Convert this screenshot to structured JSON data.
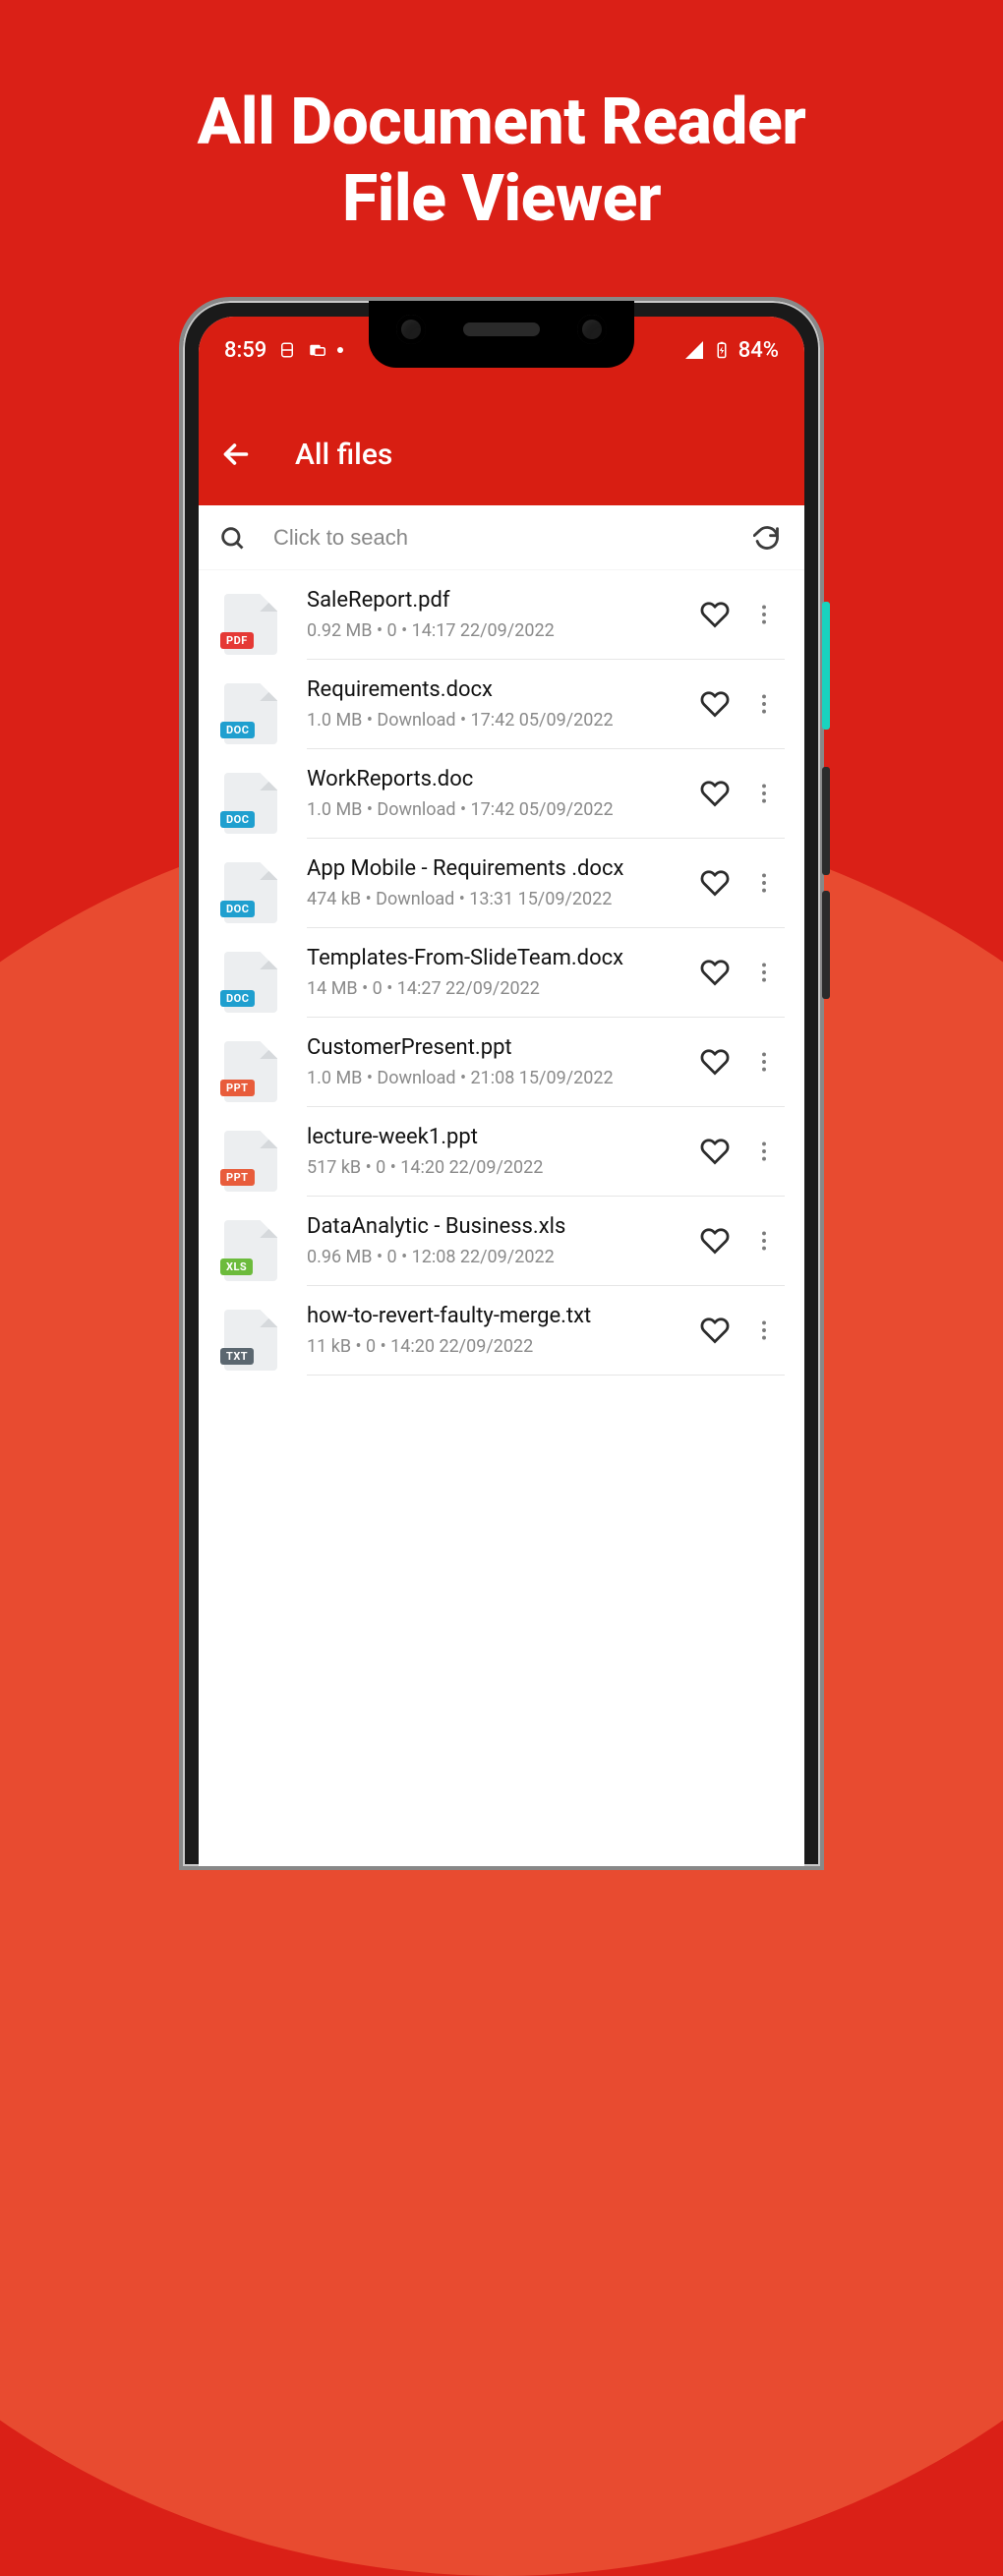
{
  "promo": {
    "line1": "All Document Reader",
    "line2": "File Viewer"
  },
  "status": {
    "time": "8:59",
    "battery": "84%"
  },
  "appbar": {
    "title": "All files"
  },
  "search": {
    "placeholder": "Click to seach"
  },
  "files": [
    {
      "type": "PDF",
      "badgeClass": "badge-pdf",
      "name": "SaleReport.pdf",
      "meta": "0.92 MB  •  0  •  14:17 22/09/2022"
    },
    {
      "type": "DOC",
      "badgeClass": "badge-doc",
      "name": "Requirements.docx",
      "meta": "1.0 MB  •  Download  •  17:42 05/09/2022"
    },
    {
      "type": "DOC",
      "badgeClass": "badge-doc",
      "name": "WorkReports.doc",
      "meta": "1.0 MB  •  Download  •  17:42 05/09/2022"
    },
    {
      "type": "DOC",
      "badgeClass": "badge-doc",
      "name": "App Mobile - Requirements .docx",
      "meta": "474 kB  •  Download  •  13:31 15/09/2022"
    },
    {
      "type": "DOC",
      "badgeClass": "badge-doc",
      "name": "Templates-From-SlideTeam.docx",
      "meta": "14 MB  •  0  •  14:27 22/09/2022"
    },
    {
      "type": "PPT",
      "badgeClass": "badge-ppt",
      "name": "CustomerPresent.ppt",
      "meta": "1.0 MB  •  Download  •  21:08 15/09/2022"
    },
    {
      "type": "PPT",
      "badgeClass": "badge-ppt",
      "name": "lecture-week1.ppt",
      "meta": "517 kB  •  0  •  14:20 22/09/2022"
    },
    {
      "type": "XLS",
      "badgeClass": "badge-xls",
      "name": "DataAnalytic - Business.xls",
      "meta": "0.96 MB  •  0  •  12:08 22/09/2022"
    },
    {
      "type": "TXT",
      "badgeClass": "badge-txt",
      "name": "how-to-revert-faulty-merge.txt",
      "meta": "11 kB  •  0  •  14:20 22/09/2022"
    }
  ]
}
